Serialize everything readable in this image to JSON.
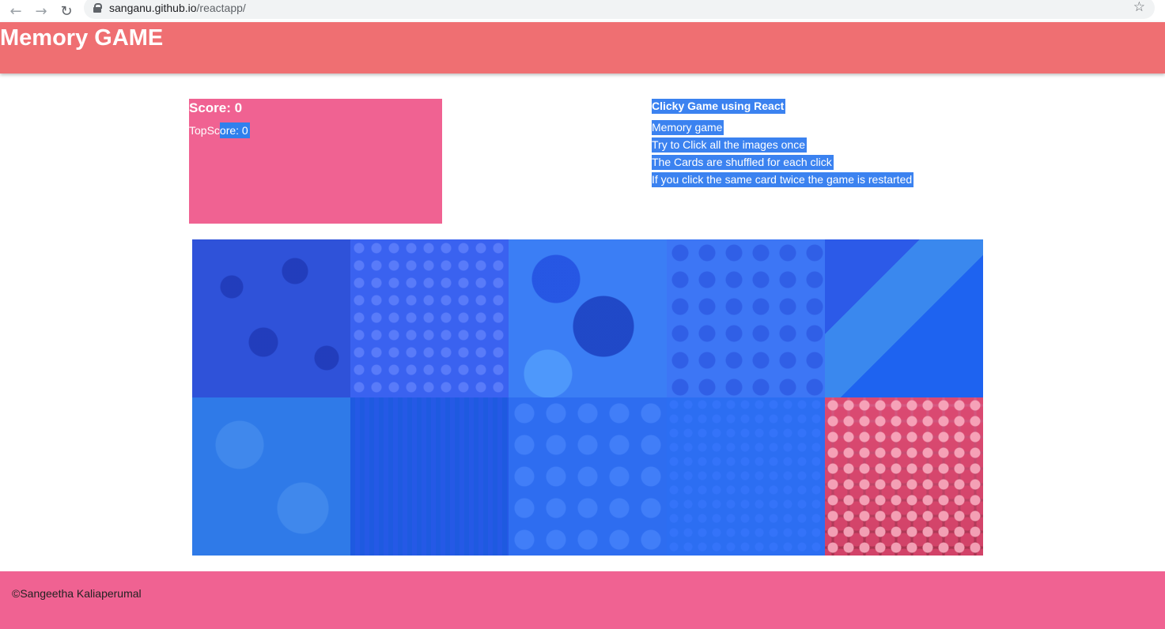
{
  "browser": {
    "url_host": "sanganu.github.io",
    "url_path": "/reactapp/",
    "back_icon": "arrow-left-icon",
    "forward_icon": "arrow-right-icon",
    "reload_icon": "reload-icon",
    "lock_icon": "lock-icon",
    "star_icon": "star-icon"
  },
  "header": {
    "title": "Memory GAME",
    "color": "#ef6f72"
  },
  "scoreboard": {
    "score_label": "Score: 0",
    "topscore_prefix": "TopSc",
    "topscore_highlighted": "ore: 0",
    "color": "#f06292"
  },
  "info": {
    "title": "Clicky Game using React",
    "lines": [
      "Memory game",
      "Try to Click all the images once",
      "The Cards are shuffled for each click",
      "If you click the same card twice the game is restarted"
    ],
    "highlight_color": "#3b82f0"
  },
  "cards": [
    {
      "name": "card-roses-blue",
      "selected": true
    },
    {
      "name": "card-small-flowers-blue",
      "selected": true
    },
    {
      "name": "card-gerbera-blue",
      "selected": true
    },
    {
      "name": "card-bouquet-blue",
      "selected": true
    },
    {
      "name": "card-garden-blue",
      "selected": true
    },
    {
      "name": "card-pale-roses-blue",
      "selected": true
    },
    {
      "name": "card-field-blue",
      "selected": true
    },
    {
      "name": "card-daisies-blue",
      "selected": true
    },
    {
      "name": "card-tiny-flowers-blue",
      "selected": true
    },
    {
      "name": "card-azaleas-pink",
      "selected": false
    }
  ],
  "footer": {
    "copyright": "©Sangeetha Kaliaperumal",
    "color": "#f06292"
  }
}
